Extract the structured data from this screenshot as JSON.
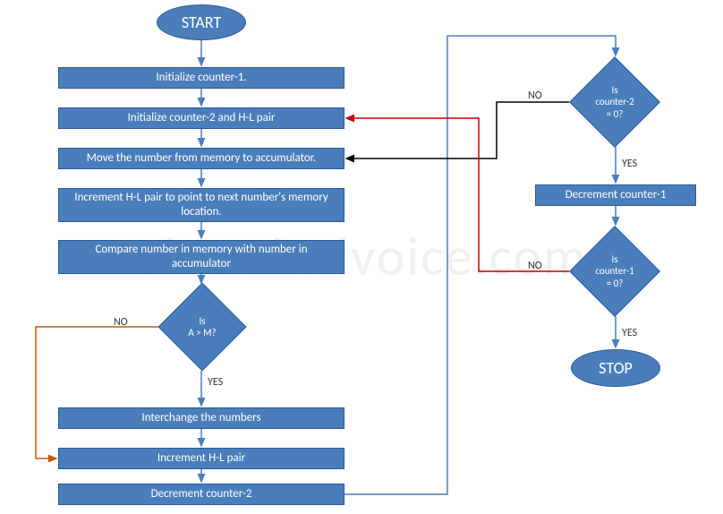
{
  "flowchart": {
    "start": "START",
    "stop": "STOP",
    "steps": {
      "init_c1": "Initialize counter-1.",
      "init_c2_hl": "Initialize counter-2 and H-L pair",
      "move_mem": "Move the number from memory to accumulator.",
      "inc_hl_next": "Increment H-L pair to point to next number's memory location.",
      "compare": "Compare number in memory with number in accumulator",
      "interchange": "Interchange the numbers",
      "inc_hl": "Increment H-L pair",
      "dec_c2": "Decrement counter-2",
      "dec_c1": "Decrement counter-1"
    },
    "decisions": {
      "a_gt_m": "Is\nA > M?",
      "c2_zero": "Is\ncounter-2\n= 0?",
      "c1_zero": "Is\ncounter-1\n= 0?"
    },
    "labels": {
      "yes": "YES",
      "no": "NO"
    }
  },
  "watermark": "electricalvoice.com",
  "colors": {
    "fill": "#4a7ebb",
    "stroke": "#2a5a95",
    "arrow_blue": "#4a7ebb",
    "arrow_red": "#C00000",
    "arrow_orange": "#C55A11",
    "arrow_black": "#000000"
  }
}
